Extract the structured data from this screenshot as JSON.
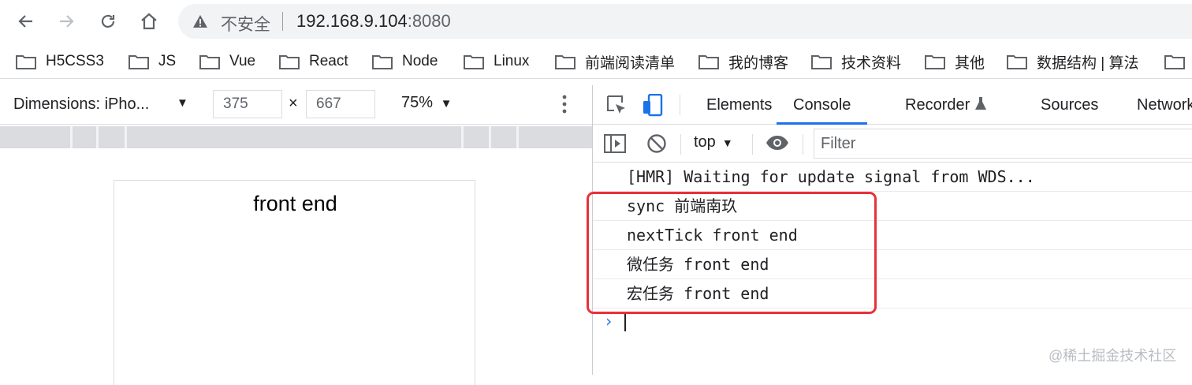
{
  "nav": {
    "security_label": "不安全",
    "url_host": "192.168.9.104",
    "url_port": ":8080"
  },
  "bookmarks": [
    {
      "label": "H5CSS3"
    },
    {
      "label": "JS"
    },
    {
      "label": "Vue"
    },
    {
      "label": "React"
    },
    {
      "label": "Node"
    },
    {
      "label": "Linux"
    },
    {
      "label": "前端阅读清单"
    },
    {
      "label": "我的博客"
    },
    {
      "label": "技术资料"
    },
    {
      "label": "其他"
    },
    {
      "label": "数据结构 | 算法"
    }
  ],
  "device_toolbar": {
    "dimensions_label": "Dimensions: iPho...",
    "width": "375",
    "height": "667",
    "times": "×",
    "zoom": "75%"
  },
  "viewport": {
    "text": "front end"
  },
  "devtools": {
    "tabs": [
      {
        "label": "Elements"
      },
      {
        "label": "Console"
      },
      {
        "label": "Recorder"
      },
      {
        "label": "Sources"
      },
      {
        "label": "Network"
      }
    ],
    "active_tab": "Console",
    "context": "top",
    "filter_placeholder": "Filter"
  },
  "console": {
    "logs": [
      {
        "text": "[HMR] Waiting for update signal from WDS..."
      },
      {
        "text": "sync 前端南玖"
      },
      {
        "text": "nextTick front end"
      },
      {
        "text": "微任务 front end"
      },
      {
        "text": "宏任务 front end"
      }
    ],
    "prompt": "›"
  },
  "watermark": "@稀土掘金技术社区",
  "colors": {
    "active_tab": "#1a73e8",
    "highlight": "#e8313a"
  }
}
